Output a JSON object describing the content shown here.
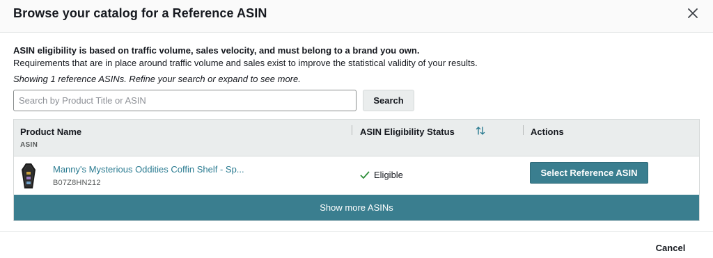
{
  "modal": {
    "title": "Browse your catalog for a Reference ASIN",
    "close_icon": "close-icon"
  },
  "info": {
    "bold_line": "ASIN eligibility is based on traffic volume, sales velocity, and must belong to a brand you own.",
    "line": "Requirements that are in place around traffic volume and sales exist to improve the statistical validity of your results.",
    "showing": "Showing 1 reference ASINs. Refine your search or expand to see more."
  },
  "search": {
    "placeholder": "Search by Product Title or ASIN",
    "value": "",
    "button_label": "Search"
  },
  "table": {
    "columns": {
      "product_name": "Product Name",
      "product_sub": "ASIN",
      "status": "ASIN Eligibility Status",
      "actions": "Actions"
    },
    "sort_icon": "sort-arrows-icon",
    "rows": [
      {
        "product_name": "Manny's Mysterious Oddities Coffin Shelf - Sp...",
        "asin": "B07Z8HN212",
        "status": "Eligible",
        "status_icon": "checkmark-icon",
        "action_label": "Select Reference ASIN"
      }
    ],
    "show_more_label": "Show more ASINs"
  },
  "footer": {
    "cancel_label": "Cancel"
  },
  "colors": {
    "accent": "#3a7e8f",
    "link": "#2a7b91",
    "check": "#2f8f3a",
    "header_bg": "#eaeded"
  }
}
